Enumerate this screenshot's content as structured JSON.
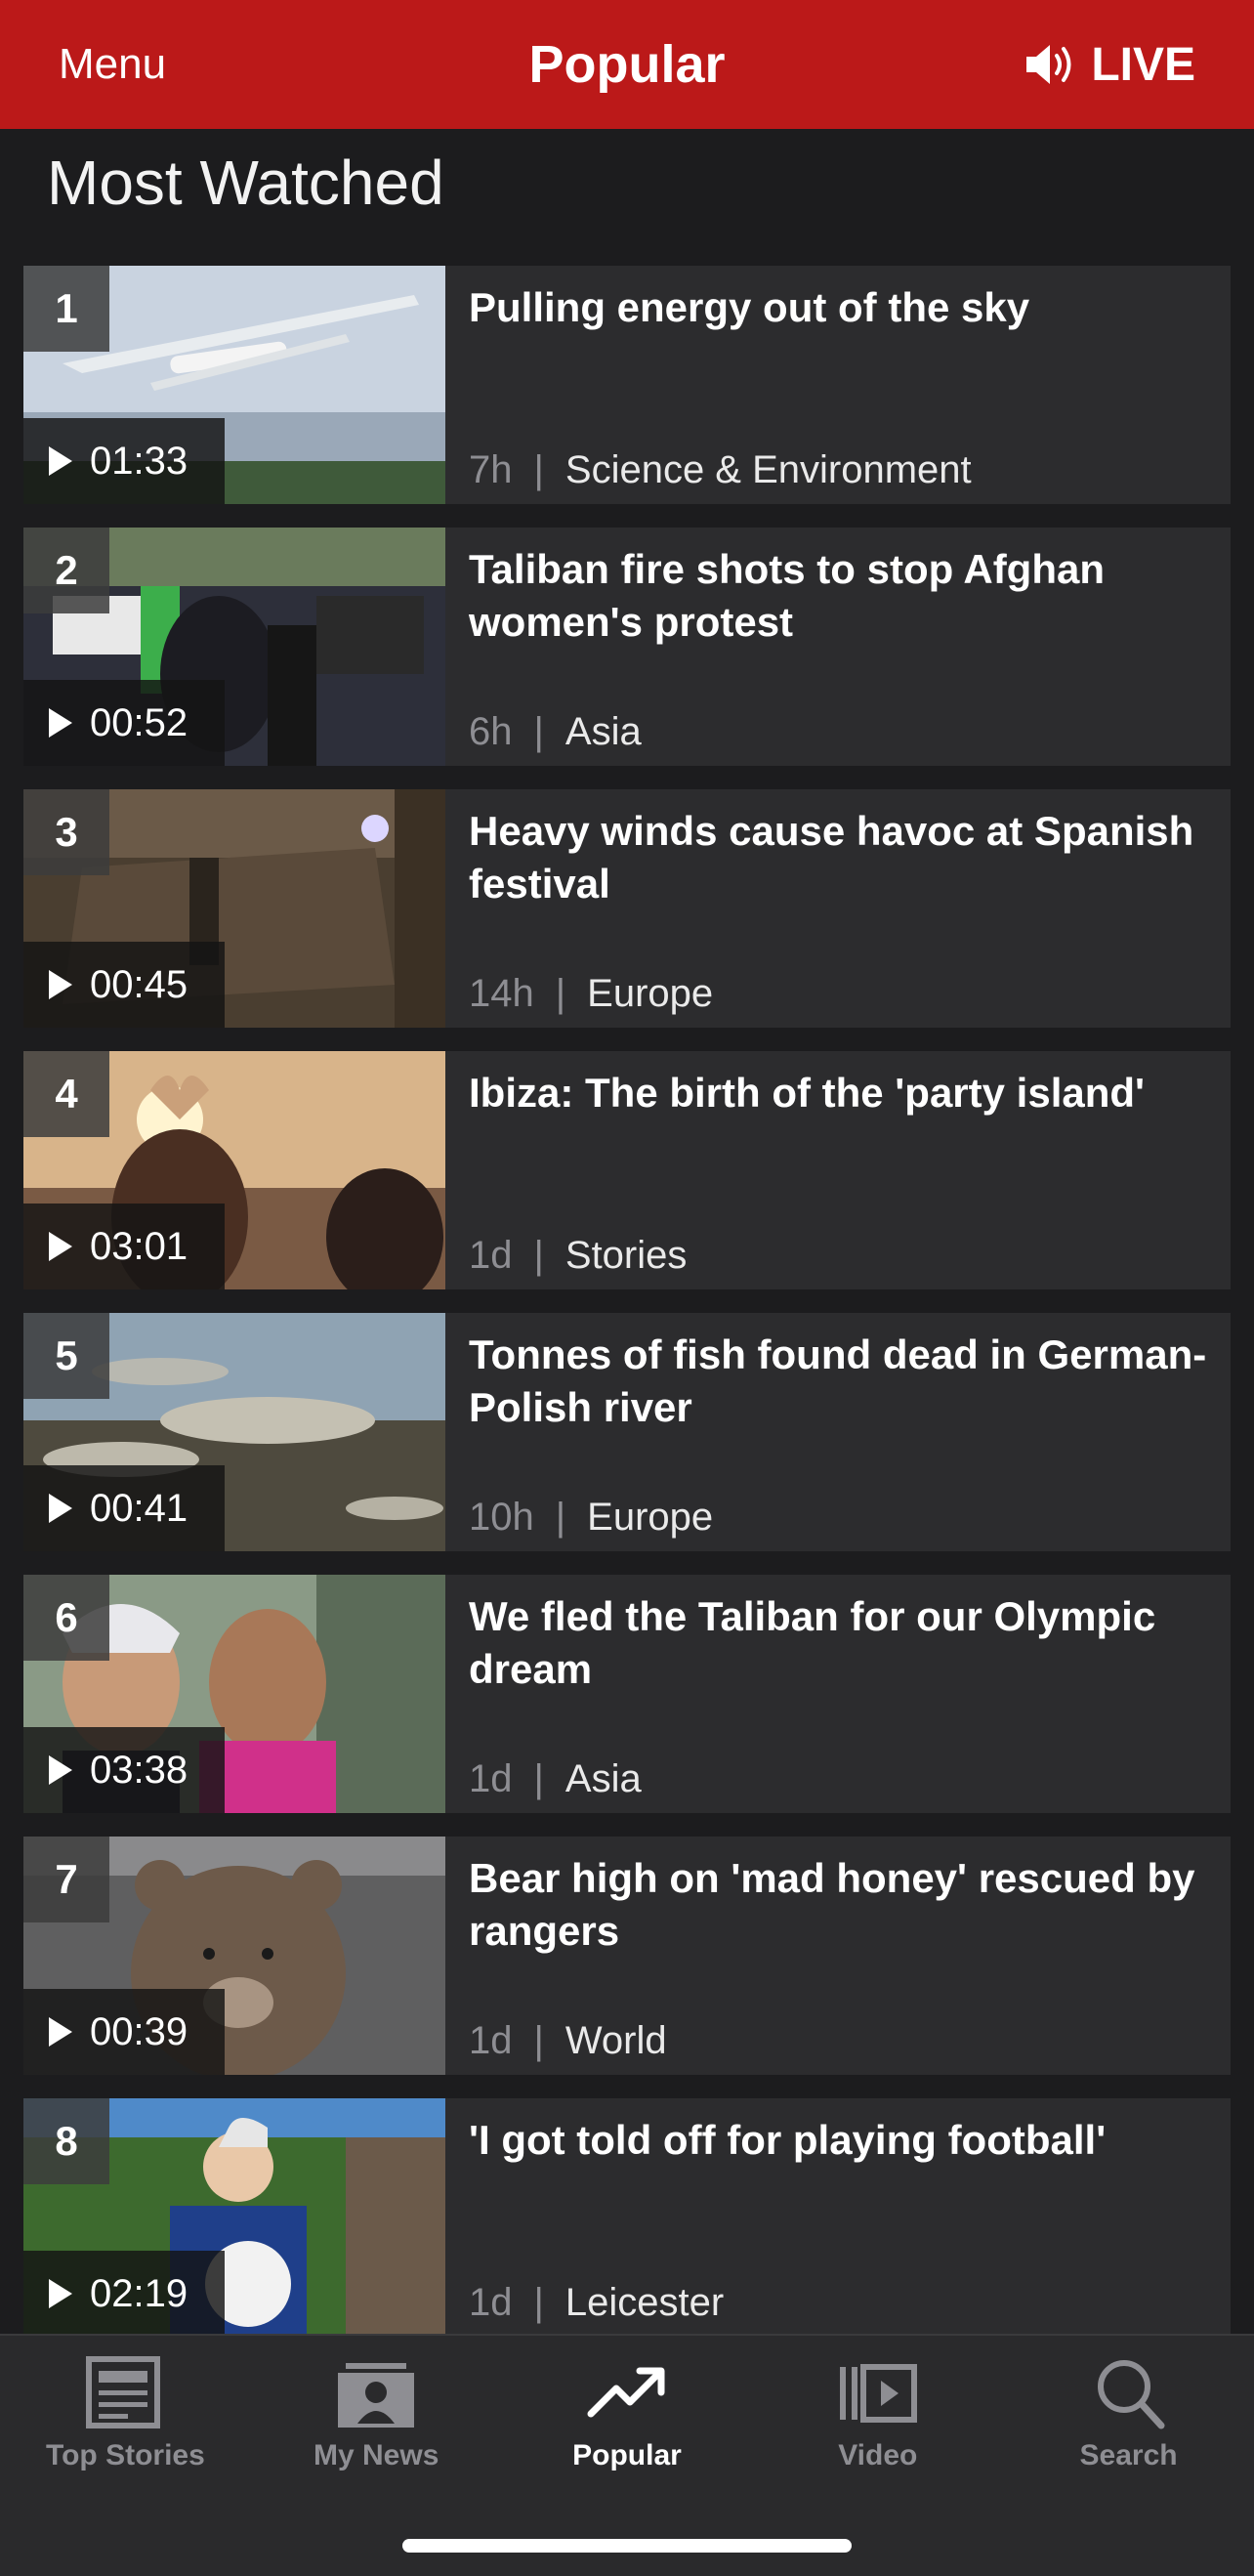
{
  "header": {
    "menu_label": "Menu",
    "title": "Popular",
    "live_label": "LIVE",
    "accent_color": "#bb1919"
  },
  "section": {
    "title": "Most Watched"
  },
  "items": [
    {
      "rank": "1",
      "duration": "01:33",
      "headline": "Pulling energy out of the sky",
      "time": "7h",
      "category": "Science & Environment"
    },
    {
      "rank": "2",
      "duration": "00:52",
      "headline": "Taliban fire shots to stop Afghan women's protest",
      "time": "6h",
      "category": "Asia"
    },
    {
      "rank": "3",
      "duration": "00:45",
      "headline": "Heavy winds cause havoc at Spanish festival",
      "time": "14h",
      "category": "Europe"
    },
    {
      "rank": "4",
      "duration": "03:01",
      "headline": "Ibiza: The birth of the 'party island'",
      "time": "1d",
      "category": "Stories"
    },
    {
      "rank": "5",
      "duration": "00:41",
      "headline": "Tonnes of fish found dead in German-Polish river",
      "time": "10h",
      "category": "Europe"
    },
    {
      "rank": "6",
      "duration": "03:38",
      "headline": "We fled the Taliban for our Olympic dream",
      "time": "1d",
      "category": "Asia"
    },
    {
      "rank": "7",
      "duration": "00:39",
      "headline": "Bear high on 'mad honey' rescued by rangers",
      "time": "1d",
      "category": "World"
    },
    {
      "rank": "8",
      "duration": "02:19",
      "headline": "'I got told off for playing football'",
      "time": "1d",
      "category": "Leicester"
    }
  ],
  "separator": "|",
  "tabs": [
    {
      "label": "Top Stories",
      "icon": "newspaper-icon",
      "active": false
    },
    {
      "label": "My News",
      "icon": "my-news-icon",
      "active": false
    },
    {
      "label": "Popular",
      "icon": "trending-icon",
      "active": true
    },
    {
      "label": "Video",
      "icon": "video-icon",
      "active": false
    },
    {
      "label": "Search",
      "icon": "search-icon",
      "active": false
    }
  ]
}
